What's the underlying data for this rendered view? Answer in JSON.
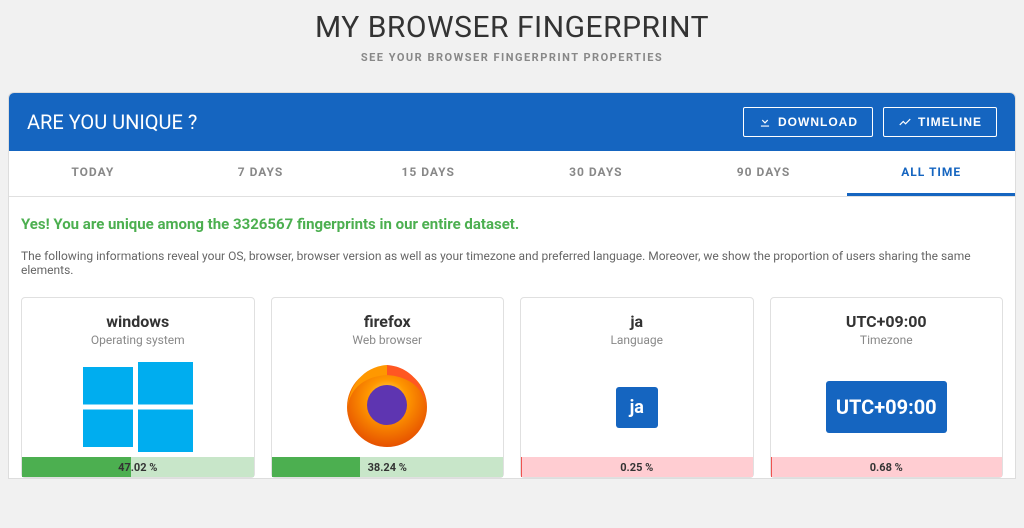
{
  "hero": {
    "title": "MY BROWSER FINGERPRINT",
    "subtitle": "SEE YOUR BROWSER FINGERPRINT PROPERTIES"
  },
  "panel": {
    "title": "ARE YOU UNIQUE ?",
    "download_label": "DOWNLOAD",
    "timeline_label": "TIMELINE"
  },
  "tabs": [
    "TODAY",
    "7 DAYS",
    "15 DAYS",
    "30 DAYS",
    "90 DAYS",
    "ALL TIME"
  ],
  "active_tab": 5,
  "unique_message": "Yes! You are unique among the 3326567 fingerprints in our entire dataset.",
  "description": "The following informations reveal your OS, browser, browser version as well as your timezone and preferred language. Moreover, we show the proportion of users sharing the same elements.",
  "cards": {
    "os": {
      "title": "windows",
      "subtitle": "Operating system",
      "pct": "47.02 %",
      "fill": 47.02,
      "color": "green"
    },
    "browser": {
      "title": "firefox",
      "subtitle": "Web browser",
      "pct": "38.24 %",
      "fill": 38.24,
      "color": "green"
    },
    "lang": {
      "title": "ja",
      "subtitle": "Language",
      "badge": "ja",
      "pct": "0.25 %",
      "fill": 0.25,
      "color": "red"
    },
    "tz": {
      "title": "UTC+09:00",
      "subtitle": "Timezone",
      "badge": "UTC+09:00",
      "pct": "0.68 %",
      "fill": 0.68,
      "color": "red"
    }
  }
}
